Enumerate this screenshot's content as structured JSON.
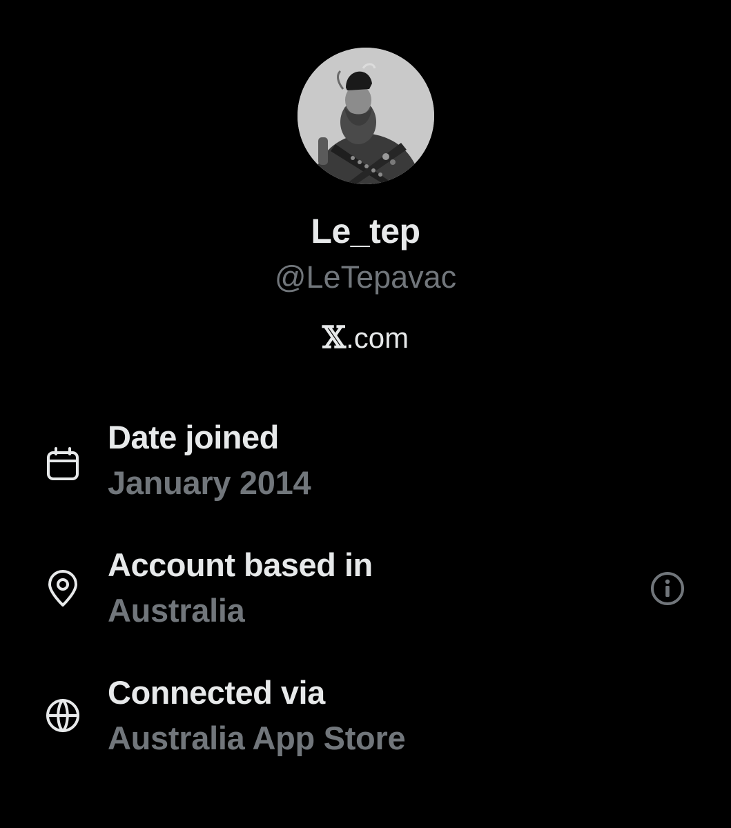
{
  "profile": {
    "display_name": "Le_tep",
    "handle": "@LeTepavac",
    "site_prefix": "𝕏",
    "site_suffix": ".com"
  },
  "details": [
    {
      "icon": "calendar-icon",
      "title": "Date joined",
      "value": "January 2014"
    },
    {
      "icon": "location-pin-icon",
      "title": "Account based in",
      "value": "Australia"
    },
    {
      "icon": "globe-icon",
      "title": "Connected via",
      "value": "Australia App Store"
    }
  ],
  "colors": {
    "background": "#000000",
    "primary_text": "#e7e9ea",
    "secondary_text": "#71767b"
  }
}
